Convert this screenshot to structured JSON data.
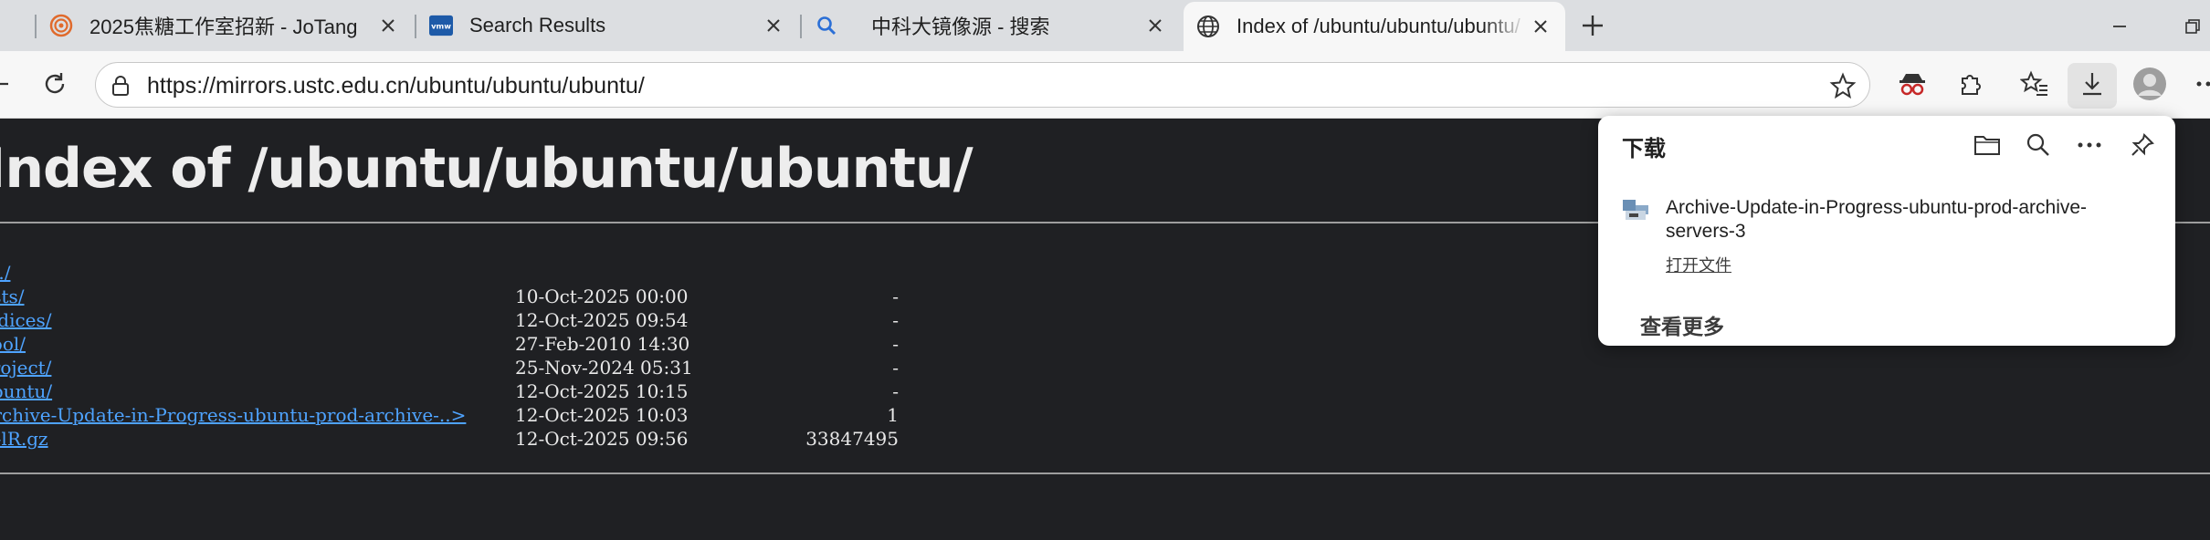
{
  "tabs": [
    {
      "title": "2025焦糖工作室招新 - JoTang",
      "icon": "jotang-favicon-icon"
    },
    {
      "title": "Search Results",
      "icon": "vmware-favicon-icon"
    },
    {
      "title": "中科大镜像源 - 搜索",
      "icon": "bing-search-favicon-icon"
    },
    {
      "title": "Index of /ubuntu/ubuntu/ubuntu/",
      "icon": "globe-icon",
      "active": true
    }
  ],
  "address_bar": {
    "url": "https://mirrors.ustc.edu.cn/ubuntu/ubuntu/ubuntu/"
  },
  "page": {
    "heading": "Index of /ubuntu/ubuntu/ubuntu/",
    "entries": [
      {
        "name": "../",
        "date": "",
        "size": ""
      },
      {
        "name": "dists/",
        "date": "10-Oct-2025 00:00",
        "size": "-"
      },
      {
        "name": "indices/",
        "date": "12-Oct-2025 09:54",
        "size": "-"
      },
      {
        "name": "pool/",
        "date": "27-Feb-2010 14:30",
        "size": "-"
      },
      {
        "name": "project/",
        "date": "25-Nov-2024 05:31",
        "size": "-"
      },
      {
        "name": "ubuntu/",
        "date": "12-Oct-2025 10:15",
        "size": "-"
      },
      {
        "name": "Archive-Update-in-Progress-ubuntu-prod-archive-..>",
        "date": "12-Oct-2025 10:03",
        "size": "1"
      },
      {
        "name": "ls-lR.gz",
        "date": "12-Oct-2025 09:56",
        "size": "33847495"
      }
    ]
  },
  "downloads": {
    "title": "下载",
    "file_name": "Archive-Update-in-Progress-ubuntu-prod-archive-servers-3",
    "open_label": "打开文件",
    "see_more_label": "查看更多"
  },
  "colors": {
    "link": "#4ea3ff",
    "page_bg": "#1f2023",
    "tabstrip_bg": "#dcdee1",
    "toolbar_bg": "#f7f7f7"
  }
}
